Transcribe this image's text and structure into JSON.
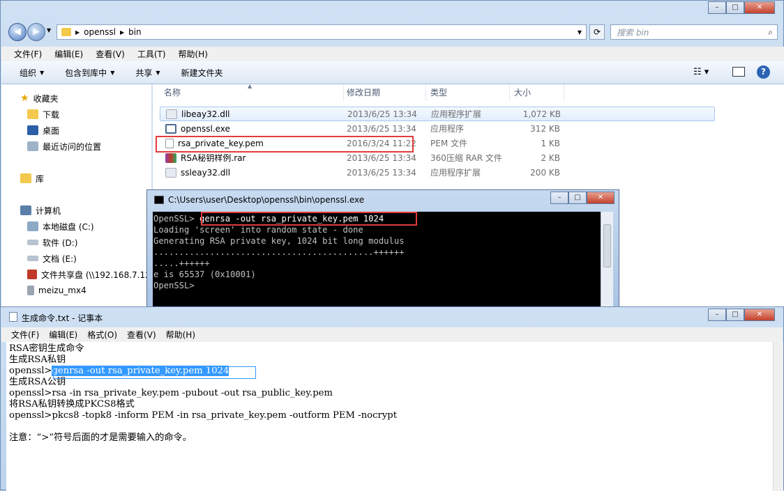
{
  "explorer": {
    "path": [
      "openssl",
      "bin"
    ],
    "search_placeholder": "搜索 bin",
    "menu": [
      "文件(F)",
      "编辑(E)",
      "查看(V)",
      "工具(T)",
      "帮助(H)"
    ],
    "toolbar": [
      "组织",
      "包含到库中",
      "共享",
      "新建文件夹"
    ],
    "nav": {
      "favorites": "收藏夹",
      "favorites_items": [
        "下载",
        "桌面",
        "最近访问的位置"
      ],
      "library": "库",
      "computer": "计算机",
      "computer_items": [
        "本地磁盘 (C:)",
        "软件 (D:)",
        "文档 (E:)",
        "文件共享盘 (\\\\192.168.7.12",
        "meizu_mx4"
      ]
    },
    "columns": [
      "名称",
      "修改日期",
      "类型",
      "大小"
    ],
    "files": [
      {
        "name": "libeay32.dll",
        "date": "2013/6/25 13:34",
        "type": "应用程序扩展",
        "size": "1,072 KB"
      },
      {
        "name": "openssl.exe",
        "date": "2013/6/25 13:34",
        "type": "应用程序",
        "size": "312 KB"
      },
      {
        "name": "rsa_private_key.pem",
        "date": "2016/3/24 11:22",
        "type": "PEM 文件",
        "size": "1 KB"
      },
      {
        "name": "RSA秘钥样例.rar",
        "date": "2013/6/25 13:34",
        "type": "360压缩 RAR 文件",
        "size": "2 KB"
      },
      {
        "name": "ssleay32.dll",
        "date": "2013/6/25 13:34",
        "type": "应用程序扩展",
        "size": "200 KB"
      }
    ]
  },
  "console": {
    "title": "C:\\Users\\user\\Desktop\\openssl\\bin\\openssl.exe",
    "prompt": "OpenSSL> ",
    "command": "genrsa -out rsa_private_key.pem 1024",
    "lines": [
      "Loading 'screen' into random state - done",
      "Generating RSA private key, 1024 bit long modulus",
      "...........................................++++++",
      ".....++++++",
      "e is 65537 (0x10001)",
      "OpenSSL>"
    ]
  },
  "notepad": {
    "title": "生成命令.txt - 记事本",
    "menu": [
      "文件(F)",
      "编辑(E)",
      "格式(O)",
      "查看(V)",
      "帮助(H)"
    ],
    "line1": "RSA密钥生成命令",
    "line2": "生成RSA私钥",
    "line3_prefix": "openssl>",
    "line3_sel": "genrsa -out rsa_private_key.pem 1024",
    "line4": "生成RSA公钥",
    "line5": "openssl>rsa -in rsa_private_key.pem -pubout -out rsa_public_key.pem",
    "line6": "将RSA私钥转换成PKCS8格式",
    "line7": "openssl>pkcs8 -topk8 -inform PEM -in rsa_private_key.pem -outform PEM -nocrypt",
    "line8": "注意：“>”符号后面的才是需要输入的命令。"
  },
  "colors": {
    "highlight_box": "#e23b3b",
    "selection": "#3399ff"
  }
}
